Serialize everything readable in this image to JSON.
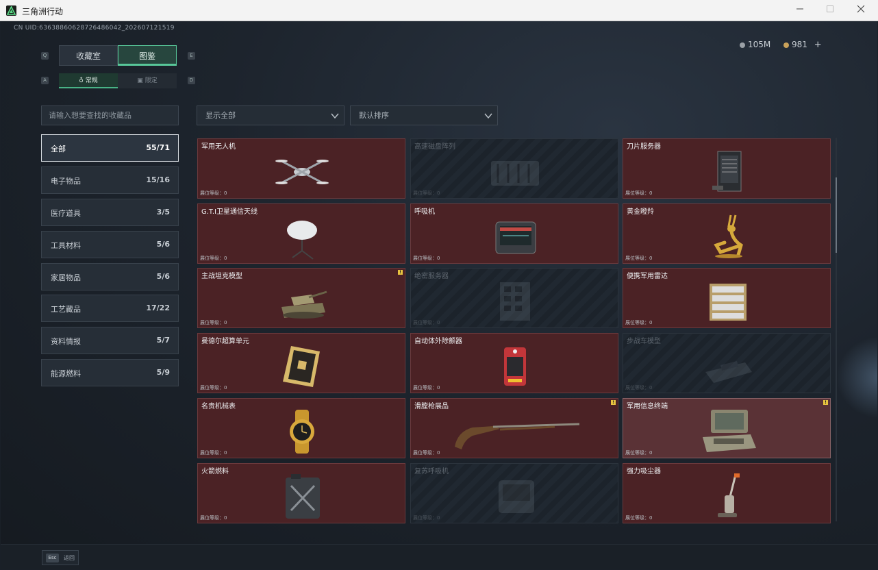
{
  "window": {
    "title": "三角洲行动"
  },
  "header": {
    "uid": "CN UID:6363886062872648604​2_202607121519",
    "currency1": "105M",
    "currency2": "981",
    "plus": "+",
    "coin1_color": "#9aa0a6",
    "coin2_color": "#c9a25a"
  },
  "tabs": [
    {
      "label": "收藏室",
      "key": "Q"
    },
    {
      "label": "图鉴",
      "key": "E"
    }
  ],
  "subtabs": [
    {
      "label": "常规",
      "key": "A"
    },
    {
      "label": "限定",
      "key": "D"
    }
  ],
  "search": {
    "placeholder": "请输入想要查找的收藏品"
  },
  "filters": {
    "display": "显示全部",
    "sort": "默认排序"
  },
  "categories": [
    {
      "label": "全部",
      "count": "55/71"
    },
    {
      "label": "电子物品",
      "count": "15/16"
    },
    {
      "label": "医疗道具",
      "count": "3/5"
    },
    {
      "label": "工具材料",
      "count": "5/6"
    },
    {
      "label": "家居物品",
      "count": "5/6"
    },
    {
      "label": "工艺藏品",
      "count": "17/22"
    },
    {
      "label": "资料情报",
      "count": "5/7"
    },
    {
      "label": "能源燃料",
      "count": "5/9"
    }
  ],
  "items": [
    {
      "name": "军用无人机",
      "level": "展位等级：0",
      "owned": true,
      "icon": "drone-icon"
    },
    {
      "name": "高速磁盘阵列",
      "level": "展位等级：0",
      "owned": false,
      "icon": "disk-array-icon"
    },
    {
      "name": "刀片服务器",
      "level": "展位等级：0",
      "owned": true,
      "icon": "blade-server-icon"
    },
    {
      "name": "G.T.I卫星通信天线",
      "level": "展位等级：0",
      "owned": true,
      "icon": "satellite-dish-icon"
    },
    {
      "name": "呼吸机",
      "level": "展位等级：0",
      "owned": true,
      "icon": "ventilator-icon"
    },
    {
      "name": "黄金瞪羚",
      "level": "展位等级：0",
      "owned": true,
      "icon": "golden-gazelle-icon"
    },
    {
      "name": "主战坦克模型",
      "level": "展位等级：0",
      "owned": true,
      "icon": "tank-model-icon",
      "badge": "!"
    },
    {
      "name": "绝密服务器",
      "level": "展位等级：0",
      "owned": false,
      "icon": "server-icon"
    },
    {
      "name": "便携军用雷达",
      "level": "展位等级：0",
      "owned": true,
      "icon": "radar-icon"
    },
    {
      "name": "曼德尔超算单元",
      "level": "展位等级：0",
      "owned": true,
      "icon": "supercomputer-unit-icon"
    },
    {
      "name": "自动体外除颤器",
      "level": "展位等级：0",
      "owned": true,
      "icon": "defibrillator-icon"
    },
    {
      "name": "步战车模型",
      "level": "展位等级：0",
      "owned": false,
      "icon": "ifv-model-icon"
    },
    {
      "name": "名贵机械表",
      "level": "展位等级：0",
      "owned": true,
      "icon": "watch-icon"
    },
    {
      "name": "滑膛枪展品",
      "level": "展位等级：0",
      "owned": true,
      "icon": "musket-icon",
      "badge": "!"
    },
    {
      "name": "军用信息终端",
      "level": "展位等级：0",
      "owned": true,
      "icon": "terminal-icon",
      "badge": "!",
      "highlight": true
    },
    {
      "name": "火箭燃料",
      "level": "展位等级：0",
      "owned": true,
      "icon": "fuel-can-icon"
    },
    {
      "name": "复苏呼吸机",
      "level": "展位等级：0",
      "owned": false,
      "icon": "resuscitator-icon"
    },
    {
      "name": "强力吸尘器",
      "level": "展位等级：0",
      "owned": true,
      "icon": "vacuum-icon"
    }
  ],
  "footer": {
    "esc_key": "Esc",
    "esc_label": "返回"
  }
}
